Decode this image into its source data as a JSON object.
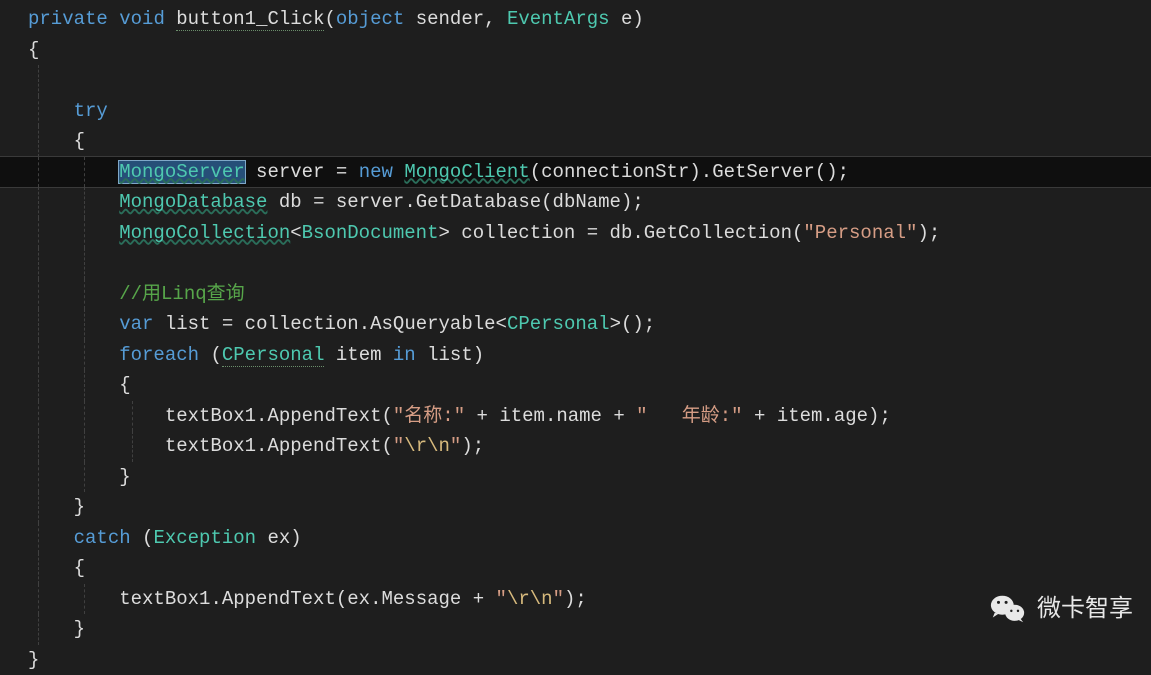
{
  "watermark": {
    "text": "微卡智享"
  },
  "code": {
    "l1": {
      "kw_private": "private",
      "kw_void": "void",
      "method": "button1_Click",
      "kw_object": "object",
      "p1": "sender",
      "type_eventargs": "EventArgs",
      "p2": "e"
    },
    "l2": {
      "brace": "{"
    },
    "l4": {
      "kw_try": "try"
    },
    "l5": {
      "brace": "{"
    },
    "l6": {
      "type_ms": "MongoServer",
      "v_server": "server",
      "eq": "=",
      "kw_new": "new",
      "type_mc": "MongoClient",
      "p_conn": "connectionStr",
      "m_gs": "GetServer"
    },
    "l7": {
      "type_md": "MongoDatabase",
      "v_db": "db",
      "eq": "=",
      "v_server": "server",
      "m_gd": "GetDatabase",
      "p_dbname": "dbName"
    },
    "l8": {
      "type_mcol": "MongoCollection",
      "type_bson": "BsonDocument",
      "v_col": "collection",
      "eq": "=",
      "v_db": "db",
      "m_gc": "GetCollection",
      "str_personal": "\"Personal\""
    },
    "l10": {
      "comment": "//用Linq查询"
    },
    "l11": {
      "kw_var": "var",
      "v_list": "list",
      "eq": "=",
      "v_col": "collection",
      "m_aq": "AsQueryable",
      "type_cp": "CPersonal"
    },
    "l12": {
      "kw_foreach": "foreach",
      "type_cp": "CPersonal",
      "v_item": "item",
      "kw_in": "in",
      "v_list": "list"
    },
    "l13": {
      "brace": "{"
    },
    "l14": {
      "v_tb": "textBox1",
      "m_ap": "AppendText",
      "str_name": "\"名称:\"",
      "plus": "+",
      "v_item": "item",
      "p_name": "name",
      "str_age": "\"   年龄:\"",
      "p_age": "age"
    },
    "l15": {
      "v_tb": "textBox1",
      "m_ap": "AppendText",
      "str_q1": "\"",
      "esc": "\\r\\n",
      "str_q2": "\""
    },
    "l16": {
      "brace": "}"
    },
    "l17": {
      "brace": "}"
    },
    "l18": {
      "kw_catch": "catch",
      "type_ex": "Exception",
      "v_ex": "ex"
    },
    "l19": {
      "brace": "{"
    },
    "l20": {
      "v_tb": "textBox1",
      "m_ap": "AppendText",
      "v_ex": "ex",
      "p_msg": "Message",
      "plus": "+",
      "str_q1": "\"",
      "esc": "\\r\\n",
      "str_q2": "\""
    },
    "l21": {
      "brace": "}"
    },
    "l22": {
      "brace": "}"
    }
  }
}
